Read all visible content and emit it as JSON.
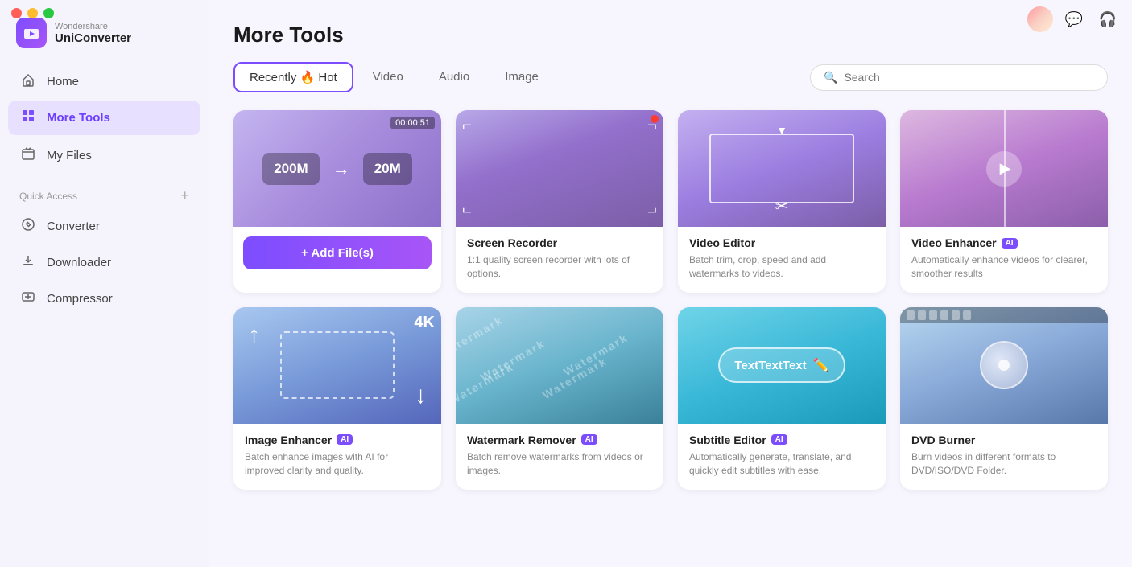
{
  "app": {
    "brand": "Wondershare",
    "name": "UniConverter"
  },
  "window_controls": {
    "close": "close",
    "minimize": "minimize",
    "maximize": "maximize"
  },
  "sidebar": {
    "nav_items": [
      {
        "id": "home",
        "label": "Home",
        "icon": "⌂"
      },
      {
        "id": "more-tools",
        "label": "More Tools",
        "icon": "⊞",
        "active": true
      }
    ],
    "my_files_label": "My Files",
    "quick_access_label": "Quick Access",
    "quick_access_items": [
      {
        "id": "converter",
        "label": "Converter",
        "icon": "⇄"
      },
      {
        "id": "downloader",
        "label": "Downloader",
        "icon": "⬇"
      },
      {
        "id": "compressor",
        "label": "Compressor",
        "icon": "⊟"
      }
    ]
  },
  "main": {
    "page_title": "More Tools",
    "tabs": [
      {
        "id": "recently-hot",
        "label": "Recently 🔥 Hot",
        "active": true
      },
      {
        "id": "video",
        "label": "Video"
      },
      {
        "id": "audio",
        "label": "Audio"
      },
      {
        "id": "image",
        "label": "Image"
      }
    ],
    "search_placeholder": "Search"
  },
  "converter_card": {
    "size_from": "200M",
    "arrow": "→",
    "size_to": "20M",
    "badge": "00:00:51",
    "add_btn": "+ Add File(s)"
  },
  "tools": [
    {
      "id": "screen-recorder",
      "title": "Screen Recorder",
      "ai": false,
      "desc": "1:1 quality screen recorder with lots of options."
    },
    {
      "id": "video-editor",
      "title": "Video Editor",
      "ai": false,
      "desc": "Batch trim, crop, speed and add watermarks to videos."
    },
    {
      "id": "video-enhancer",
      "title": "Video Enhancer",
      "ai": true,
      "desc": "Automatically enhance videos for clearer, smoother results"
    },
    {
      "id": "image-enhancer",
      "title": "Image Enhancer",
      "ai": true,
      "desc": "Batch enhance images with AI for improved clarity and quality."
    },
    {
      "id": "watermark-remover",
      "title": "Watermark Remover",
      "ai": true,
      "desc": "Batch remove watermarks from videos or images."
    },
    {
      "id": "subtitle-editor",
      "title": "Subtitle Editor",
      "ai": true,
      "desc": "Automatically generate, translate, and quickly edit subtitles with ease."
    },
    {
      "id": "dvd-burner",
      "title": "DVD Burner",
      "ai": false,
      "desc": "Burn videos in different formats to DVD/ISO/DVD Folder."
    }
  ],
  "subtitle_pill_text": "TextTextText",
  "four_k_label": "4K",
  "watermark_label": "Watermark"
}
